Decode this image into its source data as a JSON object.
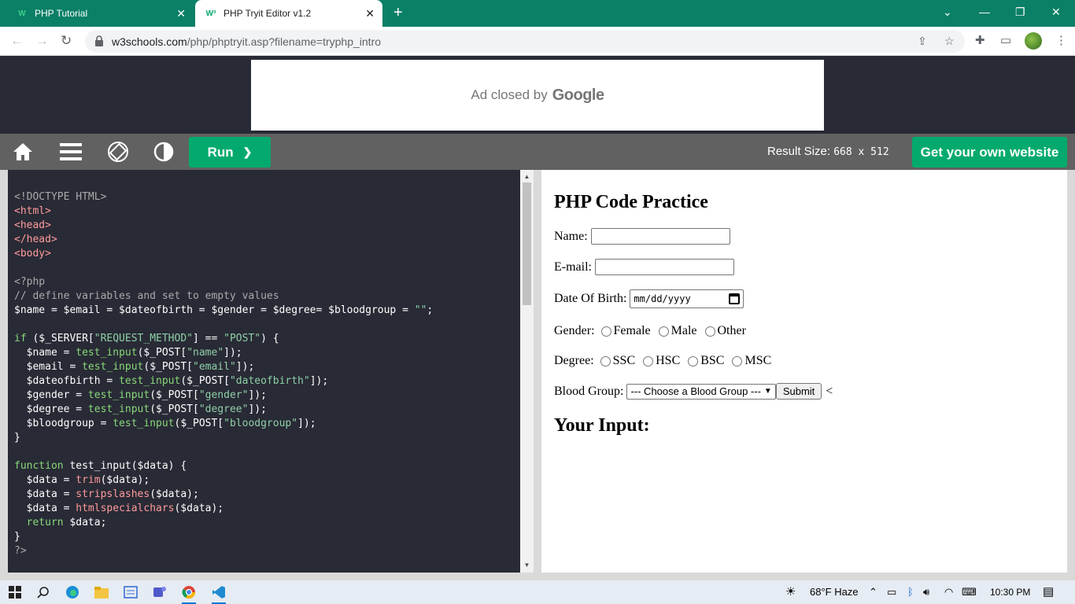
{
  "browser": {
    "tabs": [
      {
        "title": "PHP Tutorial",
        "favicon": "w3schools-icon",
        "active": false
      },
      {
        "title": "PHP Tryit Editor v1.2",
        "favicon": "w3schools-icon",
        "active": true
      }
    ],
    "tab_close_glyph": "✕",
    "new_tab_glyph": "+",
    "url_host": "w3schools.com",
    "url_rest": "/php/phptryit.asp?filename=tryphp_intro"
  },
  "ad": {
    "text": "Ad closed by",
    "brand": "Google"
  },
  "editor_bar": {
    "run_label": "Run",
    "run_glyph": "❯",
    "result_size_label": "Result Size:",
    "result_size_value": "668 x 512",
    "get_site_label": "Get your own website"
  },
  "code_lines": [
    [
      {
        "t": "<!DOCTYPE HTML>",
        "c": "doc"
      }
    ],
    [
      {
        "t": "<html>",
        "c": "tag"
      }
    ],
    [
      {
        "t": "<head>",
        "c": "tag"
      }
    ],
    [
      {
        "t": "</head>",
        "c": "tag"
      }
    ],
    [
      {
        "t": "<body>",
        "c": "tag"
      }
    ],
    [],
    [
      {
        "t": "<?php",
        "c": "doc"
      }
    ],
    [
      {
        "t": "// define variables and set to empty values",
        "c": "com"
      }
    ],
    [
      {
        "t": "$name = $email = $dateofbirth = $gender = $degree= $bloodgroup = ",
        "c": "var"
      },
      {
        "t": "\"\"",
        "c": "str"
      },
      {
        "t": ";",
        "c": "var"
      }
    ],
    [],
    [
      {
        "t": "if",
        "c": "kw"
      },
      {
        "t": " ($_SERVER[",
        "c": "var"
      },
      {
        "t": "\"REQUEST_METHOD\"",
        "c": "str"
      },
      {
        "t": "] == ",
        "c": "var"
      },
      {
        "t": "\"POST\"",
        "c": "str"
      },
      {
        "t": ") {",
        "c": "var"
      }
    ],
    [
      {
        "t": "  $name = ",
        "c": "var"
      },
      {
        "t": "test_input",
        "c": "kw"
      },
      {
        "t": "($_POST[",
        "c": "var"
      },
      {
        "t": "\"name\"",
        "c": "str"
      },
      {
        "t": "]);",
        "c": "var"
      }
    ],
    [
      {
        "t": "  $email = ",
        "c": "var"
      },
      {
        "t": "test_input",
        "c": "kw"
      },
      {
        "t": "($_POST[",
        "c": "var"
      },
      {
        "t": "\"email\"",
        "c": "str"
      },
      {
        "t": "]);",
        "c": "var"
      }
    ],
    [
      {
        "t": "  $dateofbirth = ",
        "c": "var"
      },
      {
        "t": "test_input",
        "c": "kw"
      },
      {
        "t": "($_POST[",
        "c": "var"
      },
      {
        "t": "\"dateofbirth\"",
        "c": "str"
      },
      {
        "t": "]);",
        "c": "var"
      }
    ],
    [
      {
        "t": "  $gender = ",
        "c": "var"
      },
      {
        "t": "test_input",
        "c": "kw"
      },
      {
        "t": "($_POST[",
        "c": "var"
      },
      {
        "t": "\"gender\"",
        "c": "str"
      },
      {
        "t": "]);",
        "c": "var"
      }
    ],
    [
      {
        "t": "  $degree = ",
        "c": "var"
      },
      {
        "t": "test_input",
        "c": "kw"
      },
      {
        "t": "($_POST[",
        "c": "var"
      },
      {
        "t": "\"degree\"",
        "c": "str"
      },
      {
        "t": "]);",
        "c": "var"
      }
    ],
    [
      {
        "t": "  $bloodgroup = ",
        "c": "var"
      },
      {
        "t": "test_input",
        "c": "kw"
      },
      {
        "t": "($_POST[",
        "c": "var"
      },
      {
        "t": "\"bloodgroup\"",
        "c": "str"
      },
      {
        "t": "]);",
        "c": "var"
      }
    ],
    [
      {
        "t": "}",
        "c": "var"
      }
    ],
    [],
    [
      {
        "t": "function",
        "c": "kw"
      },
      {
        "t": " test_input($data) {",
        "c": "var"
      }
    ],
    [
      {
        "t": "  $data = ",
        "c": "var"
      },
      {
        "t": "trim",
        "c": "fn"
      },
      {
        "t": "($data);",
        "c": "var"
      }
    ],
    [
      {
        "t": "  $data = ",
        "c": "var"
      },
      {
        "t": "stripslashes",
        "c": "fn"
      },
      {
        "t": "($data);",
        "c": "var"
      }
    ],
    [
      {
        "t": "  $data = ",
        "c": "var"
      },
      {
        "t": "htmlspecialchars",
        "c": "fn"
      },
      {
        "t": "($data);",
        "c": "var"
      }
    ],
    [
      {
        "t": "  ",
        "c": "var"
      },
      {
        "t": "return",
        "c": "kw"
      },
      {
        "t": " $data;",
        "c": "var"
      }
    ],
    [
      {
        "t": "}",
        "c": "var"
      }
    ],
    [
      {
        "t": "?>",
        "c": "doc"
      }
    ]
  ],
  "result": {
    "title": "PHP Code Practice",
    "name_label": "Name:",
    "email_label": "E-mail:",
    "dob_label": "Date Of Birth:",
    "dob_placeholder": "mm/dd/yyyy",
    "gender_label": "Gender:",
    "gender_options": [
      "Female",
      "Male",
      "Other"
    ],
    "degree_label": "Degree:",
    "degree_options": [
      "SSC",
      "HSC",
      "BSC",
      "MSC"
    ],
    "blood_label": "Blood Group:",
    "blood_selected": "--- Choose a Blood Group ---",
    "submit_label": "Submit",
    "trailing_text": "<",
    "your_input_heading": "Your Input:"
  },
  "taskbar": {
    "weather": "68°F  Haze",
    "time": "10:30 PM"
  },
  "colors": {
    "tabstrip": "#0a8066",
    "w3_green": "#04aa6d",
    "editor_bg": "#282a35",
    "toolbar_gray": "#616161"
  }
}
